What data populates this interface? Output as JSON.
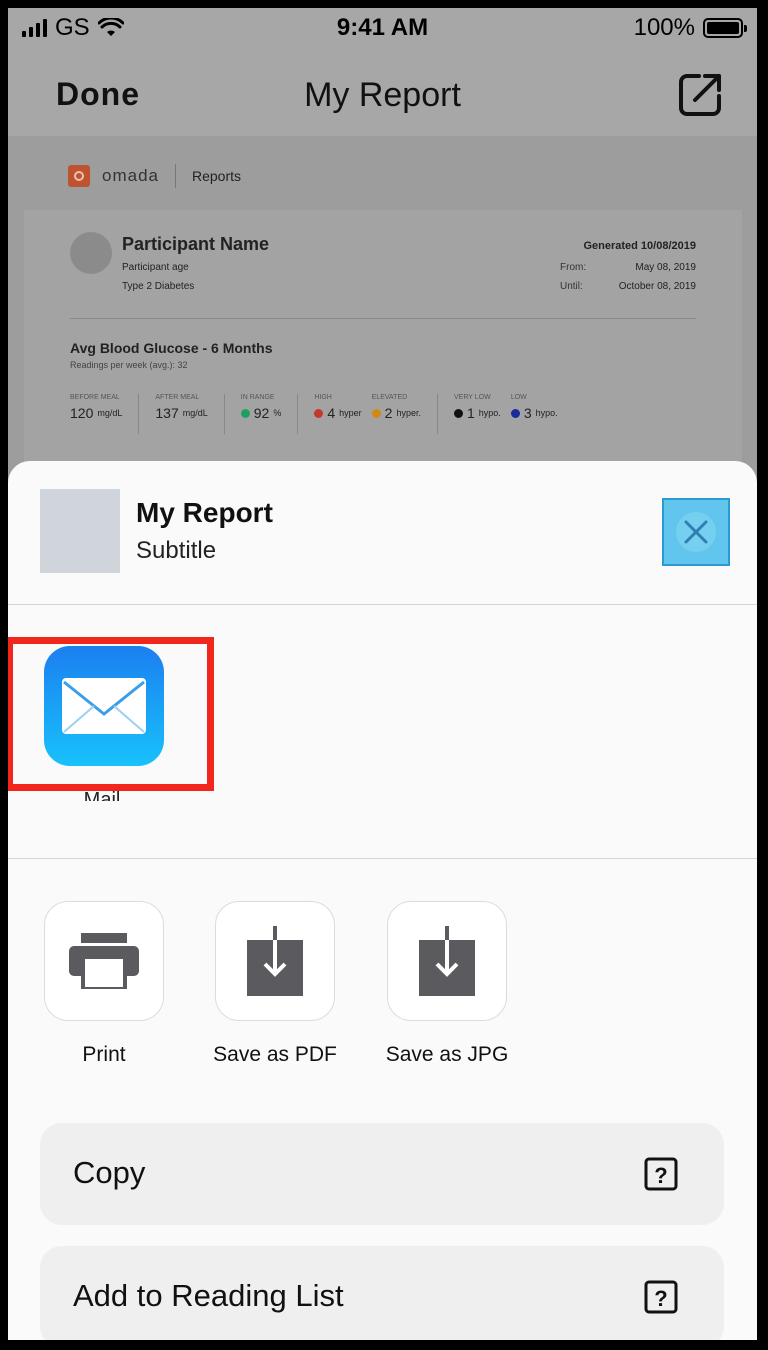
{
  "status_bar": {
    "carrier": "GS",
    "time": "9:41 AM",
    "battery": "100%"
  },
  "nav": {
    "done_label": "Done",
    "title": "My Report"
  },
  "report": {
    "brand": "omada",
    "section": "Reports",
    "participant_name": "Participant Name",
    "participant_age": "Participant age",
    "participant_type": "Type 2 Diabetes",
    "generated": "Generated 10/08/2019",
    "from_label": "From:",
    "from_value": "May 08, 2019",
    "until_label": "Until:",
    "until_value": "October 08, 2019",
    "avg_title": "Avg Blood Glucose - 6 Months",
    "readings": "Readings per week (avg.): 32",
    "metrics": [
      {
        "label": "Before meal",
        "value": "120",
        "unit": "mg/dL"
      },
      {
        "label": "After meal",
        "value": "137",
        "unit": "mg/dL"
      },
      {
        "label": "In range",
        "value": "92",
        "unit": "%",
        "color": "#1f9e62"
      },
      {
        "label": "High",
        "value": "4",
        "unit": "hyper",
        "color": "#c0392b"
      },
      {
        "label": "Elevated",
        "value": "2",
        "unit": "hyper.",
        "color": "#d08a14"
      },
      {
        "label": "Very low",
        "value": "1",
        "unit": "hypo.",
        "color": "#111111"
      },
      {
        "label": "Low",
        "value": "3",
        "unit": "hypo.",
        "color": "#1a2a9a"
      }
    ]
  },
  "sheet": {
    "title": "My Report",
    "subtitle": "Subtitle",
    "apps": [
      {
        "label": "Mail",
        "icon": "mail-icon"
      }
    ],
    "actions": [
      {
        "label": "Print",
        "icon": "printer-icon"
      },
      {
        "label": "Save as PDF",
        "icon": "download-icon"
      },
      {
        "label": "Save as JPG",
        "icon": "download-icon"
      }
    ],
    "list": [
      {
        "label": "Copy",
        "icon": "help-icon"
      },
      {
        "label": "Add to Reading List",
        "icon": "help-icon"
      }
    ]
  },
  "colors": {
    "highlight": "#f1261c",
    "close_button": "#62c5ee",
    "mail_gradient_top": "#1b7ff0",
    "mail_gradient_bottom": "#18c2fb"
  }
}
